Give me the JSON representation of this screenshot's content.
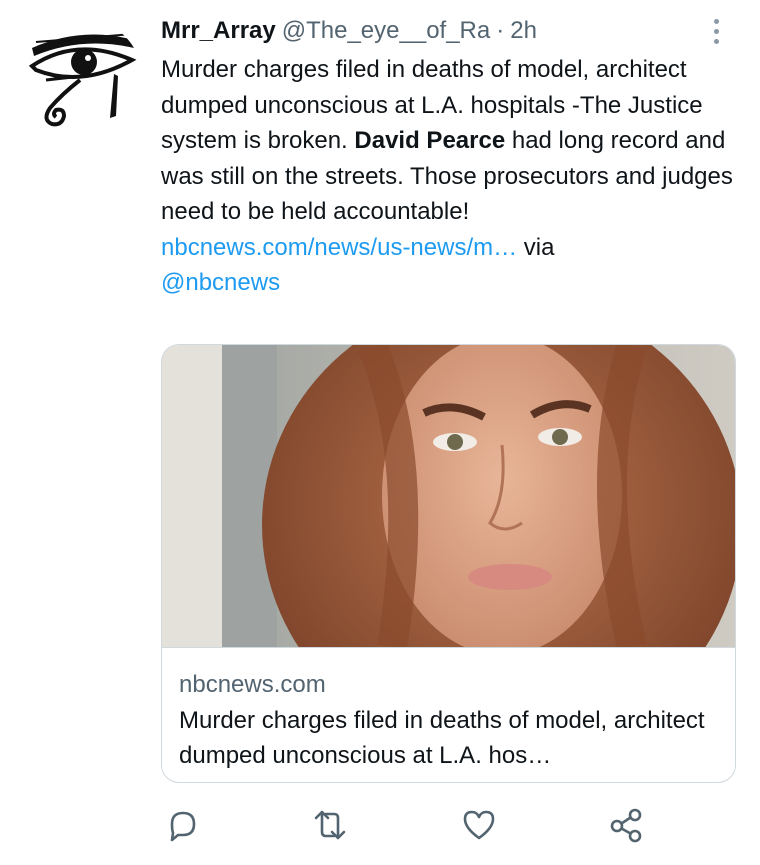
{
  "tweet": {
    "author_name": "Mrr_Array",
    "author_handle": "@The_eye__of_Ra",
    "separator": "·",
    "timestamp": "2h",
    "text_part1": "Murder charges filed in deaths of model, architect dumped unconscious at L.A. hospitals -The Justice system is broken. ",
    "text_bold": "David Pearce",
    "text_part2": " had long record and was still on the streets. Those prosecutors and judges need to be held accountable!",
    "link_text": "nbcnews.com/news/us-news/m…",
    "via_text": " via",
    "mention": "@nbcnews"
  },
  "card": {
    "domain": "nbcnews.com",
    "title": "Murder charges filed in deaths of model, architect dumped unconscious at L.A. hos…"
  },
  "icons": {
    "avatar": "eye-of-ra-icon",
    "menu": "more-vertical-icon",
    "reply": "reply-icon",
    "retweet": "retweet-icon",
    "like": "heart-icon",
    "share": "share-icon"
  },
  "colors": {
    "link": "#1d9bf0",
    "secondary_text": "#536471",
    "primary_text": "#0f1419",
    "border": "#cfd9de"
  }
}
